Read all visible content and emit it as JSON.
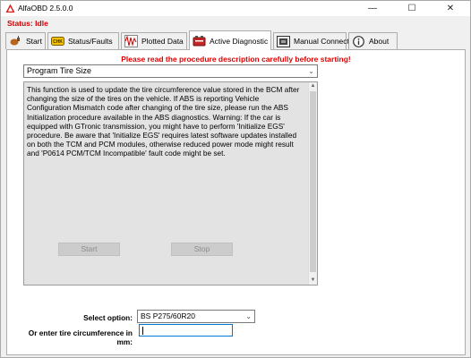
{
  "window": {
    "title": "AlfaOBD 2.5.0.0",
    "minimize_glyph": "—",
    "maximize_glyph": "☐",
    "close_glyph": "✕"
  },
  "status": "Status: Idle",
  "tabs": [
    {
      "label": "Start",
      "icon": "plug-icon"
    },
    {
      "label": "Status/Faults",
      "icon": "fault-warning-icon"
    },
    {
      "label": "Plotted Data",
      "icon": "waveform-plot-icon"
    },
    {
      "label": "Active Diagnostic",
      "icon": "car-battery-icon",
      "active": true
    },
    {
      "label": "Manual Connect",
      "icon": "ecu-module-icon"
    },
    {
      "label": "About",
      "icon": "info-icon"
    }
  ],
  "main": {
    "warning": "Please read the procedure description carefully before starting!",
    "procedure": "Program Tire Size",
    "description": "This function is used to update the tire circumference value stored in the BCM after changing the size of the tires on the vehicle. If ABS is reporting Vehicle Configuration Mismatch code after changing of the tire size, please run the ABS Initialization procedure available in the ABS diagnostics. Warning: If the car is equipped with GTronic transmission, you might have to perform 'Initialize EGS' procedure. Be aware that 'Initialize EGS' requires latest software updates installed on both the TCM and PCM modules, otherwise reduced power mode might result and 'P0614 PCM/TCM Incompatible' fault code might be set.",
    "start_label": "Start",
    "stop_label": "Stop",
    "select_option_label": "Select option:",
    "select_option_value": "BS P275/60R20",
    "circumference_label": "Or enter tire circumference in mm:",
    "circumference_value": ""
  },
  "colors": {
    "status_red": "#cc0000",
    "warning_red": "#e00000",
    "focus_blue": "#0078d7"
  }
}
